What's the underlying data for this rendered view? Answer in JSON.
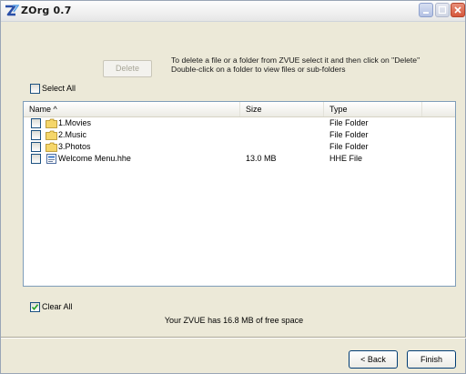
{
  "window": {
    "title": "ZOrg 0.7"
  },
  "toolbar": {
    "delete_label": "Delete",
    "info_line1": "To delete a file or a folder from ZVUE select it and then click on \"Delete\"",
    "info_line2": "Double-click on a folder to view files or sub-folders"
  },
  "select_all": {
    "label": "Select All",
    "checked": false
  },
  "list": {
    "columns": {
      "name": "Name ^",
      "size": "Size",
      "type": "Type"
    },
    "rows": [
      {
        "name": "1.Movies",
        "size": "",
        "type": "File Folder",
        "icon": "folder-icon"
      },
      {
        "name": "2.Music",
        "size": "",
        "type": "File Folder",
        "icon": "folder-icon"
      },
      {
        "name": "3.Photos",
        "size": "",
        "type": "File Folder",
        "icon": "folder-icon"
      },
      {
        "name": "Welcome Menu.hhe",
        "size": "13.0 MB",
        "type": "HHE File",
        "icon": "hhe-file-icon"
      }
    ]
  },
  "clear_all": {
    "label": "Clear All",
    "checked": true
  },
  "status": {
    "free_space_text": "Your ZVUE has 16.8 MB of free space"
  },
  "buttons": {
    "back": "< Back",
    "finish": "Finish"
  },
  "colors": {
    "window_bg": "#ECE9D8",
    "list_border": "#7f9db9",
    "close_button": "#d5573c"
  }
}
